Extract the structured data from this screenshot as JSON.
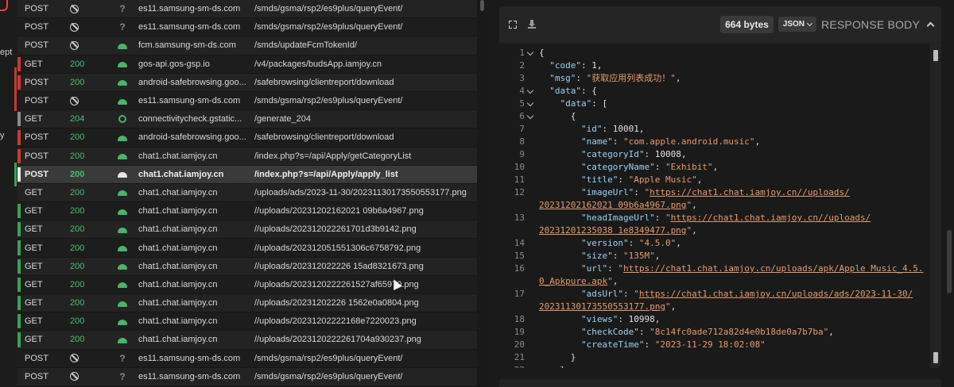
{
  "sidebar": {
    "labels": [
      "ept",
      "y"
    ]
  },
  "requests": [
    {
      "method": "POST",
      "status": "",
      "status_icon": "no-entry-icon",
      "client": "unknown",
      "host": "es11.samsung-sm-ds.com",
      "path": "/smds/gsma/rsp2/es9plus/queryEvent/",
      "mark": ""
    },
    {
      "method": "POST",
      "status": "",
      "status_icon": "no-entry-icon",
      "client": "unknown",
      "host": "es11.samsung-sm-ds.com",
      "path": "/smds/gsma/rsp2/es9plus/queryEvent/",
      "mark": ""
    },
    {
      "method": "POST",
      "status": "",
      "status_icon": "no-entry-icon",
      "client": "android",
      "host": "fcm.samsung-sm-ds.com",
      "path": "/smds/updateFcmTokenId/",
      "mark": ""
    },
    {
      "method": "GET",
      "status": "200",
      "status_icon": "",
      "client": "android",
      "host": "gos-api.gos-gsp.io",
      "path": "/v4/packages/budsApp.iamjoy.cn",
      "mark": "#c93a32"
    },
    {
      "method": "POST",
      "status": "200",
      "status_icon": "",
      "client": "android",
      "host": "android-safebrowsing.goo...",
      "path": "/safebrowsing/clientreport/download",
      "mark": "#c93a32"
    },
    {
      "method": "POST",
      "status": "",
      "status_icon": "no-entry-icon",
      "client": "android",
      "host": "es11.samsung-sm-ds.com",
      "path": "/smds/gsma/rsp2/es9plus/queryEvent/",
      "mark": ""
    },
    {
      "method": "GET",
      "status": "204",
      "status_icon": "",
      "client": "chrome",
      "host": "connectivitycheck.gstatic...",
      "path": "/generate_204",
      "mark": "#8a8a8a"
    },
    {
      "method": "POST",
      "status": "200",
      "status_icon": "",
      "client": "android",
      "host": "android-safebrowsing.goo...",
      "path": "/safebrowsing/clientreport/download",
      "mark": "#c93a32"
    },
    {
      "method": "POST",
      "status": "200",
      "status_icon": "",
      "client": "android",
      "host": "chat1.chat.iamjoy.cn",
      "path": "/index.php?s=/api/Apply/getCategoryList",
      "mark": "#c93a32"
    },
    {
      "method": "POST",
      "status": "200",
      "status_icon": "",
      "client": "android",
      "host": "chat1.chat.iamjoy.cn",
      "path": "/index.php?s=/api/Apply/apply_list",
      "mark": "#e6e6e6",
      "selected": true
    },
    {
      "method": "GET",
      "status": "200",
      "status_icon": "",
      "client": "android",
      "host": "chat1.chat.iamjoy.cn",
      "path": "/uploads/ads/2023-11-30/20231130173550553177.png",
      "mark": ""
    },
    {
      "method": "GET",
      "status": "200",
      "status_icon": "",
      "client": "android",
      "host": "chat1.chat.iamjoy.cn",
      "path": "//uploads/20231202162021 09b6a4967.png",
      "mark": "#3aa05a"
    },
    {
      "method": "GET",
      "status": "200",
      "status_icon": "",
      "client": "android",
      "host": "chat1.chat.iamjoy.cn",
      "path": "//uploads/202312022261701d3b9142.png",
      "mark": "#3aa05a"
    },
    {
      "method": "GET",
      "status": "200",
      "status_icon": "",
      "client": "android",
      "host": "chat1.chat.iamjoy.cn",
      "path": "//uploads/202312051551306c6758792.png",
      "mark": "#3aa05a"
    },
    {
      "method": "GET",
      "status": "200",
      "status_icon": "",
      "client": "android",
      "host": "chat1.chat.iamjoy.cn",
      "path": "//uploads/202312022226 15ad8321673.png",
      "mark": "#3aa05a"
    },
    {
      "method": "GET",
      "status": "200",
      "status_icon": "",
      "client": "android",
      "host": "chat1.chat.iamjoy.cn",
      "path": "//uploads/2023120222261527af65970.png",
      "mark": "#3aa05a"
    },
    {
      "method": "GET",
      "status": "200",
      "status_icon": "",
      "client": "android",
      "host": "chat1.chat.iamjoy.cn",
      "path": "//uploads/20231202226 1562e0a0804.png",
      "mark": "#3aa05a"
    },
    {
      "method": "GET",
      "status": "200",
      "status_icon": "",
      "client": "android",
      "host": "chat1.chat.iamjoy.cn",
      "path": "//uploads/20231202222168e7220023.png",
      "mark": "#3aa05a"
    },
    {
      "method": "GET",
      "status": "200",
      "status_icon": "",
      "client": "android",
      "host": "chat1.chat.iamjoy.cn",
      "path": "//uploads/2023120222261704a930237.png",
      "mark": "#3aa05a"
    },
    {
      "method": "POST",
      "status": "",
      "status_icon": "no-entry-icon",
      "client": "unknown",
      "host": "es11.samsung-sm-ds.com",
      "path": "/smds/gsma/rsp2/es9plus/queryEvent/",
      "mark": ""
    },
    {
      "method": "POST",
      "status": "",
      "status_icon": "no-entry-icon",
      "client": "unknown",
      "host": "es11.samsung-sm-ds.com",
      "path": "/smds/gsma/rsp2/es9plus/queryEvent/",
      "mark": ""
    }
  ],
  "response": {
    "size_label": "664 bytes",
    "format": "JSON",
    "section_title": "RESPONSE BODY",
    "lines": [
      {
        "n": "1",
        "fold": true,
        "tokens": [
          [
            "n",
            "{"
          ]
        ]
      },
      {
        "n": "2",
        "fold": false,
        "tokens": [
          [
            "n",
            "  "
          ],
          [
            "k",
            "\"code\""
          ],
          [
            "n",
            ": 1,"
          ]
        ]
      },
      {
        "n": "3",
        "fold": false,
        "tokens": [
          [
            "n",
            "  "
          ],
          [
            "k",
            "\"msg\""
          ],
          [
            "n",
            ": "
          ],
          [
            "s",
            "\"获取应用列表成功！\""
          ],
          [
            "n",
            ","
          ]
        ]
      },
      {
        "n": "4",
        "fold": true,
        "tokens": [
          [
            "n",
            "  "
          ],
          [
            "k",
            "\"data\""
          ],
          [
            "n",
            ": {"
          ]
        ]
      },
      {
        "n": "5",
        "fold": true,
        "tokens": [
          [
            "n",
            "    "
          ],
          [
            "k",
            "\"data\""
          ],
          [
            "n",
            ": ["
          ]
        ]
      },
      {
        "n": "6",
        "fold": true,
        "tokens": [
          [
            "n",
            "      {"
          ]
        ]
      },
      {
        "n": "7",
        "fold": false,
        "tokens": [
          [
            "n",
            "        "
          ],
          [
            "k",
            "\"id\""
          ],
          [
            "n",
            ": 10001,"
          ]
        ]
      },
      {
        "n": "8",
        "fold": false,
        "tokens": [
          [
            "n",
            "        "
          ],
          [
            "k",
            "\"name\""
          ],
          [
            "n",
            ": "
          ],
          [
            "s",
            "\"com.apple.android.music\""
          ],
          [
            "n",
            ","
          ]
        ]
      },
      {
        "n": "9",
        "fold": false,
        "tokens": [
          [
            "n",
            "        "
          ],
          [
            "k",
            "\"categoryId\""
          ],
          [
            "n",
            ": 10008,"
          ]
        ]
      },
      {
        "n": "10",
        "fold": false,
        "tokens": [
          [
            "n",
            "        "
          ],
          [
            "k",
            "\"categoryName\""
          ],
          [
            "n",
            ": "
          ],
          [
            "s",
            "\"Exhibit\""
          ],
          [
            "n",
            ","
          ]
        ]
      },
      {
        "n": "11",
        "fold": false,
        "tokens": [
          [
            "n",
            "        "
          ],
          [
            "k",
            "\"title\""
          ],
          [
            "n",
            ": "
          ],
          [
            "s",
            "\"Apple Music\""
          ],
          [
            "n",
            ","
          ]
        ]
      },
      {
        "n": "12",
        "fold": false,
        "tokens": [
          [
            "n",
            "        "
          ],
          [
            "k",
            "\"imageUrl\""
          ],
          [
            "n",
            ": "
          ],
          [
            "s",
            "\""
          ],
          [
            "u",
            "https://chat1.chat.iamjoy.cn//uploads/"
          ]
        ]
      },
      {
        "n": "",
        "fold": false,
        "tokens": [
          [
            "u",
            "20231202162021 09b6a4967.png"
          ],
          [
            "s",
            "\""
          ],
          [
            "n",
            ","
          ]
        ],
        "wrap": true
      },
      {
        "n": "13",
        "fold": false,
        "tokens": [
          [
            "n",
            "        "
          ],
          [
            "k",
            "\"headImageUrl\""
          ],
          [
            "n",
            ": "
          ],
          [
            "s",
            "\""
          ],
          [
            "u",
            "https://chat1.chat.iamjoy.cn//uploads/"
          ]
        ]
      },
      {
        "n": "",
        "fold": false,
        "tokens": [
          [
            "u",
            "20231201235038 1e8349477.png"
          ],
          [
            "s",
            "\""
          ],
          [
            "n",
            ","
          ]
        ],
        "wrap": true
      },
      {
        "n": "14",
        "fold": false,
        "tokens": [
          [
            "n",
            "        "
          ],
          [
            "k",
            "\"version\""
          ],
          [
            "n",
            ": "
          ],
          [
            "s",
            "\"4.5.0\""
          ],
          [
            "n",
            ","
          ]
        ]
      },
      {
        "n": "15",
        "fold": false,
        "tokens": [
          [
            "n",
            "        "
          ],
          [
            "k",
            "\"size\""
          ],
          [
            "n",
            ": "
          ],
          [
            "s",
            "\"135M\""
          ],
          [
            "n",
            ","
          ]
        ]
      },
      {
        "n": "16",
        "fold": false,
        "tokens": [
          [
            "n",
            "        "
          ],
          [
            "k",
            "\"url\""
          ],
          [
            "n",
            ": "
          ],
          [
            "s",
            "\""
          ],
          [
            "u",
            "https://chat1.chat.iamjoy.cn/uploads/apk/Apple Music_4.5."
          ]
        ]
      },
      {
        "n": "",
        "fold": false,
        "tokens": [
          [
            "u",
            "0_Apkpure.apk"
          ],
          [
            "s",
            "\""
          ],
          [
            "n",
            ","
          ]
        ],
        "wrap": true
      },
      {
        "n": "17",
        "fold": false,
        "tokens": [
          [
            "n",
            "        "
          ],
          [
            "k",
            "\"adsUrl\""
          ],
          [
            "n",
            ": "
          ],
          [
            "s",
            "\""
          ],
          [
            "u",
            "https://chat1.chat.iamjoy.cn/uploads/ads/2023-11-30/"
          ]
        ]
      },
      {
        "n": "",
        "fold": false,
        "tokens": [
          [
            "u",
            "20231130173550553177.png"
          ],
          [
            "s",
            "\""
          ],
          [
            "n",
            ","
          ]
        ],
        "wrap": true
      },
      {
        "n": "18",
        "fold": false,
        "tokens": [
          [
            "n",
            "        "
          ],
          [
            "k",
            "\"views\""
          ],
          [
            "n",
            ": 10998,"
          ]
        ]
      },
      {
        "n": "19",
        "fold": false,
        "tokens": [
          [
            "n",
            "        "
          ],
          [
            "k",
            "\"checkCode\""
          ],
          [
            "n",
            ": "
          ],
          [
            "s",
            "\"8c14fc0ade712a82d4e0b18de0a7b7ba\""
          ],
          [
            "n",
            ","
          ]
        ]
      },
      {
        "n": "20",
        "fold": false,
        "tokens": [
          [
            "n",
            "        "
          ],
          [
            "k",
            "\"createTime\""
          ],
          [
            "n",
            ": "
          ],
          [
            "s",
            "\"2023-11-29 18:02:08\""
          ]
        ]
      },
      {
        "n": "21",
        "fold": false,
        "tokens": [
          [
            "n",
            "      }"
          ]
        ]
      },
      {
        "n": "22",
        "fold": false,
        "tokens": [
          [
            "n",
            "    }"
          ]
        ]
      }
    ]
  },
  "colors": {
    "status_ok": "#46c070",
    "mark_red": "#c93a32",
    "mark_green": "#3aa05a",
    "json_key": "#9cd2f4",
    "json_string": "#e79a6d"
  }
}
